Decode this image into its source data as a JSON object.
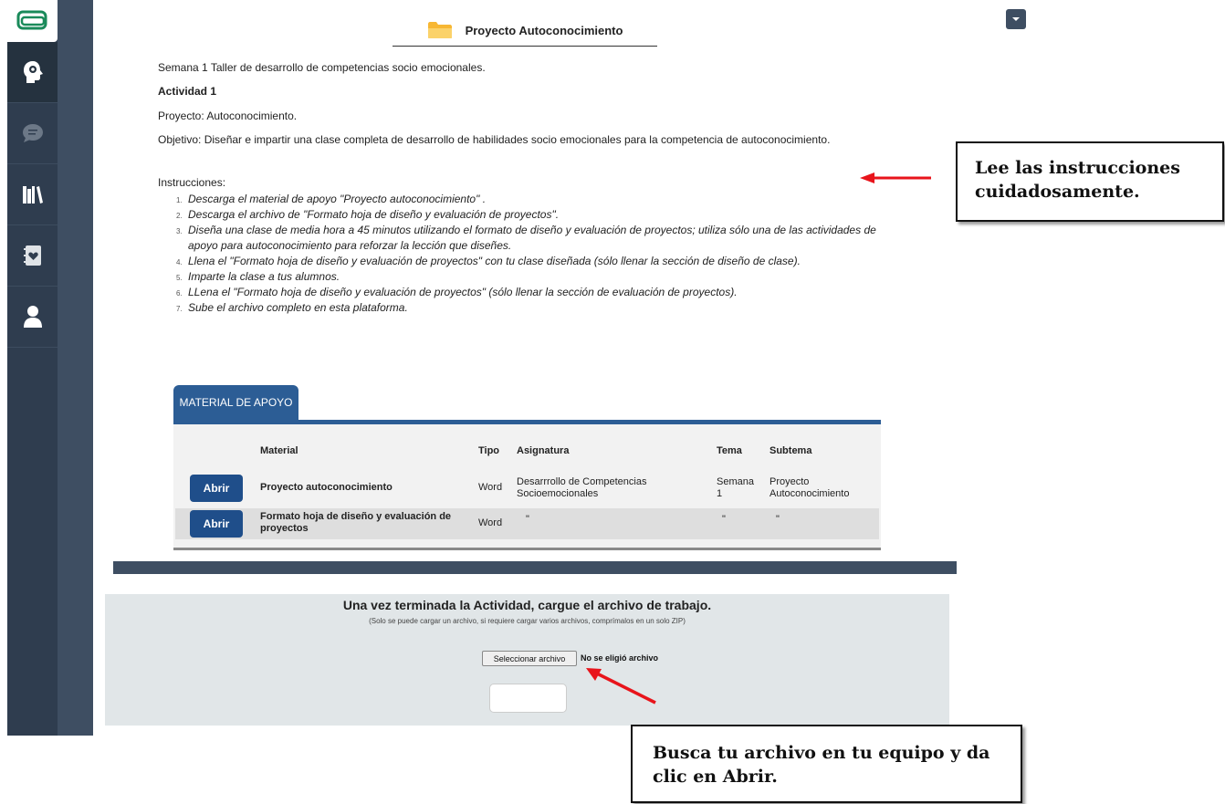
{
  "sidebar": {
    "items": [
      {
        "icon": "logo-icon"
      },
      {
        "icon": "head-gear-icon"
      },
      {
        "icon": "chat-icon"
      },
      {
        "icon": "library-icon"
      },
      {
        "icon": "heart-notebook-icon"
      },
      {
        "icon": "user-icon"
      }
    ]
  },
  "header": {
    "title": "Proyecto Autoconocimiento",
    "folder_icon": "folder-icon"
  },
  "content": {
    "intro": "Semana 1 Taller de desarrollo de competencias socio emocionales.",
    "activity": "Actividad 1",
    "project": "Proyecto: Autoconocimiento.",
    "objective": "Objetivo: Diseñar e impartir una clase completa de desarrollo de habilidades socio emocionales para la competencia de autoconocimiento.",
    "instructions_label": "Instrucciones:",
    "steps": [
      {
        "n": "1.",
        "text": "Descarga el material de apoyo \"Proyecto autoconocimiento\" ."
      },
      {
        "n": "2.",
        "text": "Descarga el archivo de \"Formato hoja de diseño y evaluación de proyectos\"."
      },
      {
        "n": "3.",
        "text": "Diseña una clase de media hora a 45 minutos utilizando el formato de diseño y evaluación de proyectos; utiliza sólo una de las actividades de apoyo para autoconocimiento para reforzar la lección que diseñes."
      },
      {
        "n": "4.",
        "text": "Llena el \"Formato hoja de diseño y evaluación de proyectos\" con tu clase diseñada (sólo llenar la sección de diseño de clase)."
      },
      {
        "n": "5.",
        "text": "Imparte la clase a tus alumnos."
      },
      {
        "n": "6.",
        "text": "LLena el \"Formato hoja de diseño y evaluación de proyectos\" (sólo llenar la sección de evaluación de proyectos)."
      },
      {
        "n": "7.",
        "text": "Sube el archivo completo en esta plataforma."
      }
    ]
  },
  "material": {
    "tab_label": "MATERIAL DE APOYO",
    "headers": {
      "material": "Material",
      "tipo": "Tipo",
      "asignatura": "Asignatura",
      "tema": "Tema",
      "subtema": "Subtema"
    },
    "rows": [
      {
        "button": "Abrir",
        "material": "Proyecto autoconocimiento",
        "tipo": "Word",
        "asignatura": "Desarrrollo de Competencias Socioemocionales",
        "tema": "Semana 1",
        "subtema": "Proyecto Autoconocimiento"
      },
      {
        "button": "Abrir",
        "material": "Formato hoja de diseño y evaluación de proyectos",
        "tipo": "Word",
        "asignatura": "\"",
        "tema": "\"",
        "subtema": "\""
      }
    ]
  },
  "upload": {
    "title": "Una vez terminada la Actividad, cargue el archivo de trabajo.",
    "note": "(Solo se puede cargar un archivo, si requiere cargar varios archivos, comprímalos en un solo ZIP)",
    "file_button": "Seleccionar archivo",
    "file_status": "No se eligió archivo"
  },
  "callouts": {
    "instructions": "Lee las instrucciones cuidadosamente.",
    "upload": "Busca tu archivo en tu equipo y da clic en Abrir."
  },
  "colors": {
    "sidebar": "#2f3d4f",
    "accent": "#2c5d95",
    "button": "#1f4e8a",
    "arrow": "#e8141b"
  }
}
